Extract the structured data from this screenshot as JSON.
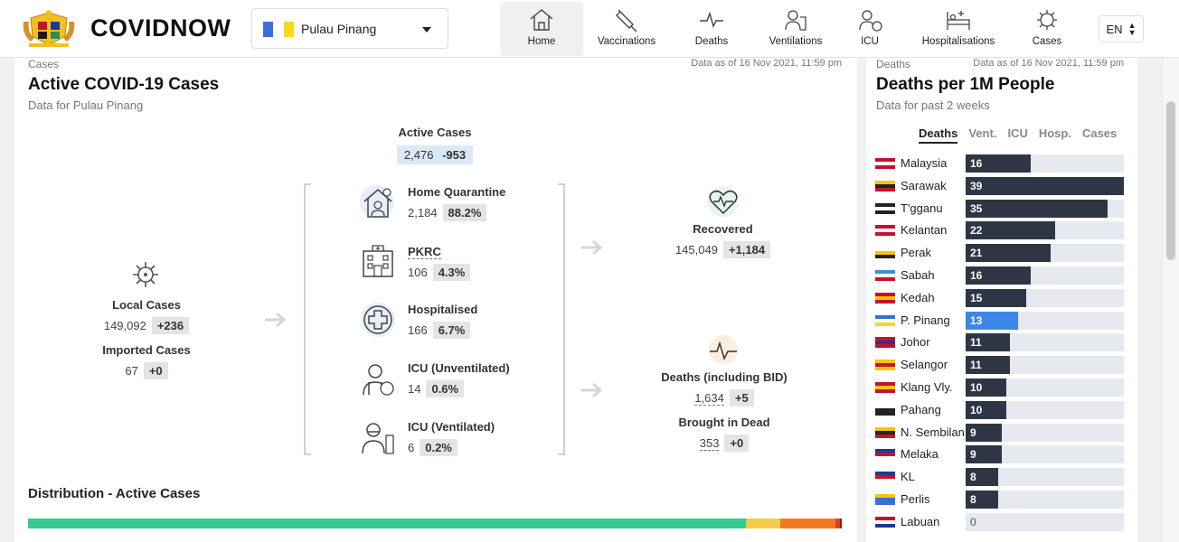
{
  "header": {
    "app_name": "COVIDNOW",
    "state_select": {
      "value": "Pulau Pinang"
    },
    "nav": [
      {
        "label": "Home",
        "icon": "home-icon",
        "active": true
      },
      {
        "label": "Vaccinations",
        "icon": "syringe-icon",
        "active": false
      },
      {
        "label": "Deaths",
        "icon": "pulse-icon",
        "active": false
      },
      {
        "label": "Ventilations",
        "icon": "ventilator-icon",
        "active": false
      },
      {
        "label": "ICU",
        "icon": "icu-icon",
        "active": false
      },
      {
        "label": "Hospitalisations",
        "icon": "hospital-bed-icon",
        "active": false
      },
      {
        "label": "Cases",
        "icon": "virus-icon",
        "active": false
      }
    ],
    "language": "EN"
  },
  "cases_panel": {
    "kicker": "Cases",
    "data_as_of": "Data as of 16 Nov 2021, 11:59 pm",
    "title": "Active COVID-19 Cases",
    "subtitle": "Data for Pulau Pinang",
    "active_cases": {
      "label": "Active Cases",
      "value": "2,476",
      "change": "-953"
    },
    "local_cases": {
      "label": "Local Cases",
      "value": "149,092",
      "change": "+236"
    },
    "imported_cases": {
      "label": "Imported Cases",
      "value": "67",
      "change": "+0"
    },
    "home_quarantine": {
      "label": "Home Quarantine",
      "value": "2,184",
      "pct": "88.2%"
    },
    "pkrc": {
      "label": "PKRC",
      "value": "106",
      "pct": "4.3%"
    },
    "hospitalised": {
      "label": "Hospitalised",
      "value": "166",
      "pct": "6.7%"
    },
    "icu_unventilated": {
      "label": "ICU (Unventilated)",
      "value": "14",
      "pct": "0.6%"
    },
    "icu_ventilated": {
      "label": "ICU (Ventilated)",
      "value": "6",
      "pct": "0.2%"
    },
    "recovered": {
      "label": "Recovered",
      "value": "145,049",
      "change": "+1,184"
    },
    "deaths": {
      "label": "Deaths (including BID)",
      "value": "1,634",
      "change": "+5"
    },
    "bid": {
      "label": "Brought in Dead",
      "value": "353",
      "change": "+0"
    },
    "distribution_title": "Distribution - Active Cases",
    "distribution": [
      {
        "share": 0.882,
        "color": "#36c990"
      },
      {
        "share": 0.043,
        "color": "#f5cc4a"
      },
      {
        "share": 0.067,
        "color": "#f07a22"
      },
      {
        "share": 0.006,
        "color": "#d9412a"
      },
      {
        "share": 0.002,
        "color": "#8e1b1b"
      }
    ]
  },
  "deaths_panel": {
    "kicker": "Deaths",
    "data_as_of": "Data as of 16 Nov 2021, 11:59 pm",
    "title": "Deaths per 1M People",
    "subtitle": "Data for past 2 weeks",
    "tabs": [
      "Deaths",
      "Vent.",
      "ICU",
      "Hosp.",
      "Cases"
    ],
    "active_tab": "Deaths",
    "highlight_color": "#3e86e6",
    "bar_color": "#2e3646"
  },
  "chart_data": {
    "type": "bar",
    "categories": [
      "Malaysia",
      "Sarawak",
      "T'gganu",
      "Kelantan",
      "Perak",
      "Sabah",
      "Kedah",
      "P. Pinang",
      "Johor",
      "Selangor",
      "Klang Vly.",
      "Pahang",
      "N. Sembilan",
      "Melaka",
      "KL",
      "Perlis",
      "Labuan"
    ],
    "values": [
      16,
      39,
      35,
      22,
      21,
      16,
      15,
      13,
      11,
      11,
      10,
      10,
      9,
      9,
      8,
      8,
      0
    ],
    "title": "Deaths per 1M People",
    "subtitle": "Data for past 2 weeks",
    "xlabel": "",
    "ylabel": "",
    "xlim": [
      0,
      39
    ],
    "highlight": "P. Pinang",
    "orientation": "horizontal"
  }
}
